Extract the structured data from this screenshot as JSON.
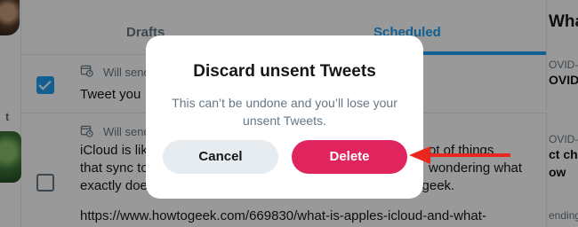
{
  "tabs": {
    "drafts": "Drafts",
    "scheduled": "Scheduled"
  },
  "tweets": [
    {
      "meta": "Will send",
      "line1": "Tweet you"
    },
    {
      "meta": "Will send",
      "line1": "iCloud is like",
      "line2": "that sync to",
      "line3": "exactly doe",
      "line4": "https://www.howtogeek.com/669830/what-is-apples-icloud-and-what-",
      "frag1": "ot of things",
      "frag2": "wondering what",
      "frag3": "togeek."
    }
  ],
  "sidebar_right": {
    "title": "What",
    "items": [
      "OVID-",
      "OVID",
      "OVID-",
      "ct cha",
      "ow",
      "ending"
    ]
  },
  "sidebar_left": {
    "label": "t"
  },
  "dialog": {
    "title": "Discard unsent Tweets",
    "message": "This can’t be undone and you’ll lose your unsent Tweets.",
    "cancel": "Cancel",
    "delete": "Delete"
  },
  "colors": {
    "accent": "#1da1f2",
    "delete": "#e0245e",
    "annotation_arrow": "#e8281e"
  }
}
